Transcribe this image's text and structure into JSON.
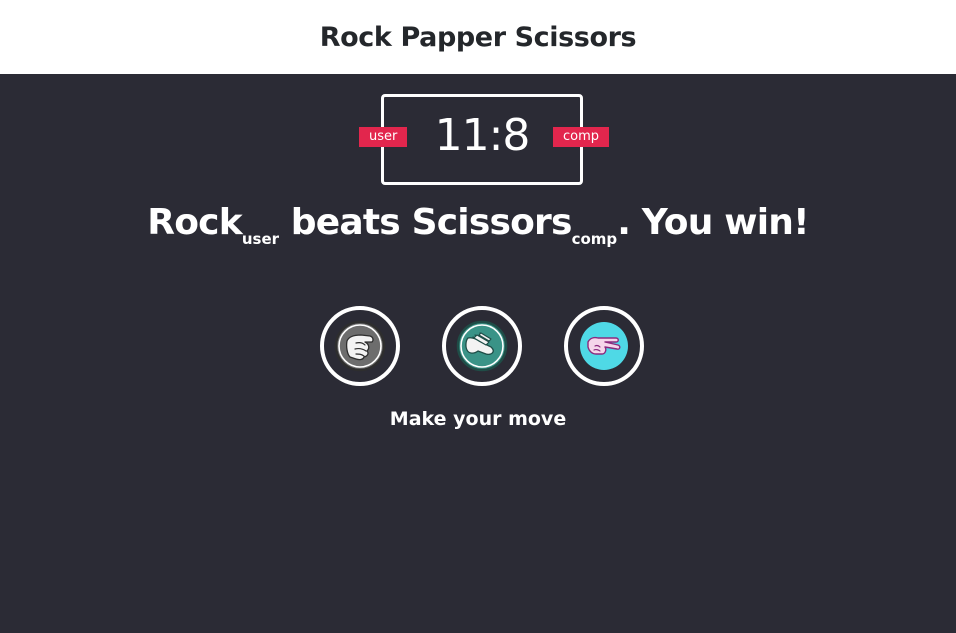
{
  "header": {
    "title": "Rock Papper Scissors"
  },
  "scoreboard": {
    "user_score": 11,
    "comp_score": 8,
    "score_text": "11:8",
    "user_label": "user",
    "comp_label": "comp",
    "badge_color": "#e2264d"
  },
  "result": {
    "user_choice": "Rock",
    "user_sub": "user",
    "verb": "beats",
    "comp_choice": "Scissors",
    "comp_sub": "comp",
    "outcome": ". You win!"
  },
  "choices": [
    {
      "name": "rock",
      "icon": "rock-fist-icon",
      "color": "#6d6d6d"
    },
    {
      "name": "paper",
      "icon": "paper-hand-icon",
      "color": "#3a9387"
    },
    {
      "name": "scissors",
      "icon": "scissors-fingers-icon",
      "color": "#4fd9e6"
    }
  ],
  "prompt": "Make your move",
  "colors": {
    "background": "#2b2b35",
    "header_bg": "#ffffff",
    "header_text": "#24272b",
    "text": "#ffffff"
  }
}
